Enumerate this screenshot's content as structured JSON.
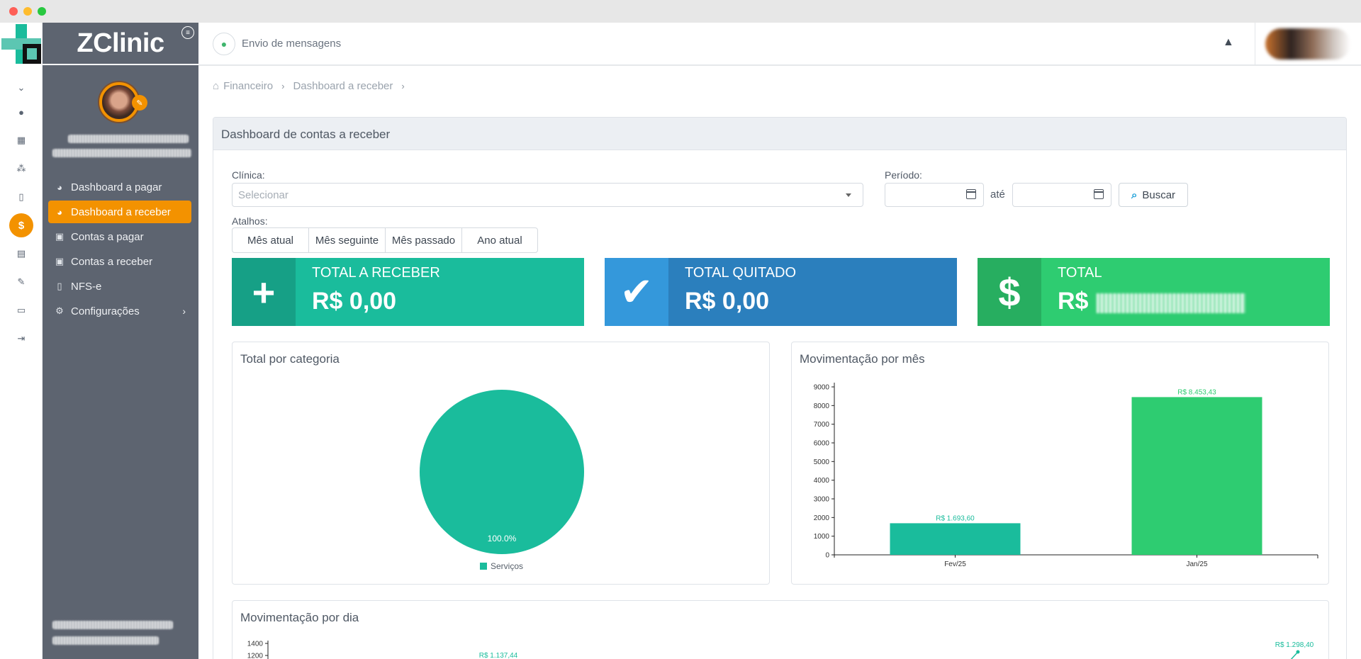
{
  "brand": {
    "name": "ZClinic"
  },
  "header": {
    "messages_label": "Envio de mensagens"
  },
  "sidebar": {
    "items": [
      {
        "label": "Dashboard a pagar",
        "icon": "pie-chart-icon"
      },
      {
        "label": "Dashboard a receber",
        "icon": "pie-chart-icon",
        "active": true
      },
      {
        "label": "Contas a pagar",
        "icon": "money-bill-icon"
      },
      {
        "label": "Contas a receber",
        "icon": "money-bill-icon"
      },
      {
        "label": "NFS-e",
        "icon": "file-icon"
      },
      {
        "label": "Configurações",
        "icon": "gears-icon",
        "has_submenu": true
      }
    ]
  },
  "rail": {
    "icons": [
      "chevron-down-icon",
      "user-circle-icon",
      "calendar-icon",
      "users-icon",
      "clipboard-icon",
      "dollar-icon",
      "archive-icon",
      "edit-icon",
      "document-icon",
      "sign-out-icon"
    ],
    "active": "dollar-icon"
  },
  "breadcrumb": {
    "items": [
      "Financeiro",
      "Dashboard a receber"
    ]
  },
  "page": {
    "title": "Dashboard de contas a receber",
    "clinic_label": "Clínica:",
    "clinic_placeholder": "Selecionar",
    "period_label": "Período:",
    "until_label": "até",
    "search_button": "Buscar",
    "shortcuts_label": "Atalhos:",
    "shortcuts": [
      "Mês atual",
      "Mês seguinte",
      "Mês passado",
      "Ano atual"
    ]
  },
  "stats": [
    {
      "title": "TOTAL A RECEBER",
      "value": "R$ 0,00",
      "color": "#1abc9c",
      "icon_color": "#16a086",
      "icon": "plus-icon"
    },
    {
      "title": "TOTAL QUITADO",
      "value": "R$ 0,00",
      "color": "#2b7fbd",
      "icon_color": "#3498db",
      "icon": "check-icon"
    },
    {
      "title": "TOTAL",
      "value": "R$",
      "color": "#2ecc71",
      "icon_color": "#27ae60",
      "icon": "dollar-icon"
    }
  ],
  "panels": {
    "category": "Total por categoria",
    "month": "Movimentação por mês",
    "day": "Movimentação por dia"
  },
  "chart_data": [
    {
      "type": "pie",
      "title": "Total por categoria",
      "slices": [
        {
          "label": "Serviços",
          "value": 100.0,
          "display": "100.0%"
        }
      ],
      "colors": [
        "#1abc9c"
      ],
      "legend": "bottom"
    },
    {
      "type": "bar",
      "title": "Movimentação por mês",
      "categories": [
        "Fev/25",
        "Jan/25"
      ],
      "values": [
        1693.6,
        8453.43
      ],
      "labels": [
        "R$ 1.693,60",
        "R$ 8.453,43"
      ],
      "colors": [
        "#1abc9c",
        "#2ecc71"
      ],
      "yticks": [
        0,
        1000,
        2000,
        3000,
        4000,
        5000,
        6000,
        7000,
        8000,
        9000
      ],
      "ylim": [
        0,
        9000
      ],
      "grid": false
    },
    {
      "type": "line",
      "title": "Movimentação por dia",
      "yticks_visible": [
        1400,
        1200
      ],
      "labels_visible": [
        "R$ 1.137,44",
        "R$ 1.298,40"
      ]
    }
  ]
}
